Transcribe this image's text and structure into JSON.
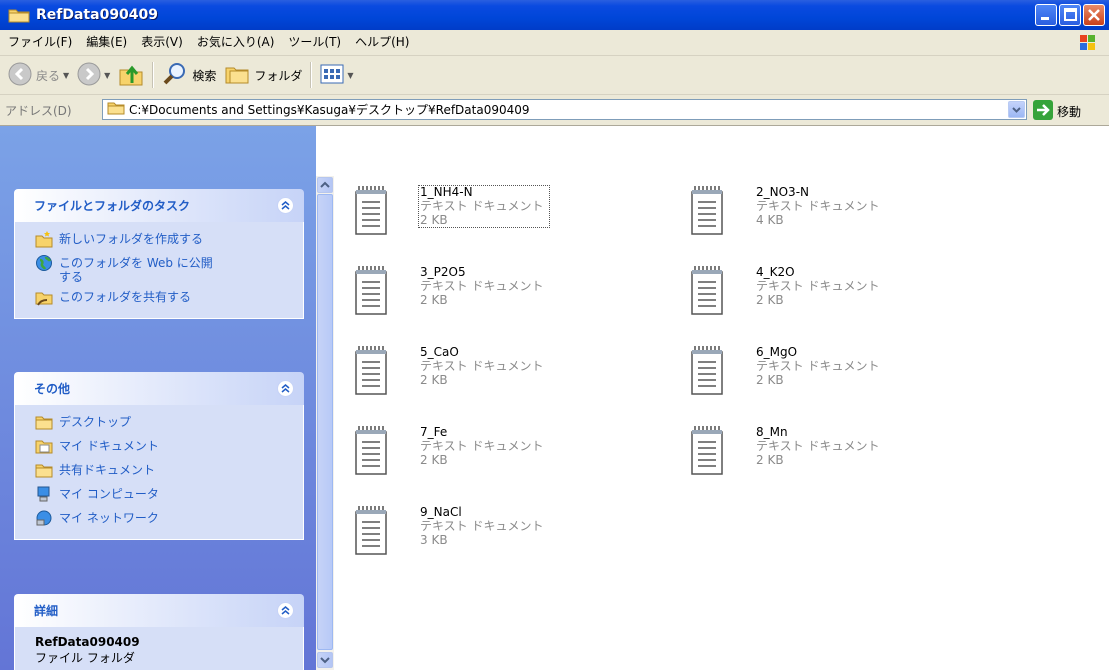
{
  "window": {
    "title": "RefData090409"
  },
  "menu": [
    "ファイル(F)",
    "編集(E)",
    "表示(V)",
    "お気に入り(A)",
    "ツール(T)",
    "ヘルプ(H)"
  ],
  "toolbar": {
    "back": "戻る",
    "search": "検索",
    "folders": "フォルダ"
  },
  "address": {
    "label": "アドレス(D)",
    "path": "C:¥Documents and Settings¥Kasuga¥デスクトップ¥RefData090409",
    "go": "移動"
  },
  "tasks": {
    "title": "ファイルとフォルダのタスク",
    "items": [
      "新しいフォルダを作成する",
      "このフォルダを Web に公開\nする",
      "このフォルダを共有する"
    ]
  },
  "other": {
    "title": "その他",
    "items": [
      "デスクトップ",
      "マイ ドキュメント",
      "共有ドキュメント",
      "マイ コンピュータ",
      "マイ ネットワーク"
    ]
  },
  "details": {
    "title": "詳細",
    "name": "RefData090409",
    "type": "ファイル フォルダ"
  },
  "files": [
    {
      "name": "1_NH4-N",
      "type": "テキスト ドキュメント",
      "size": "2 KB"
    },
    {
      "name": "2_NO3-N",
      "type": "テキスト ドキュメント",
      "size": "4 KB"
    },
    {
      "name": "3_P2O5",
      "type": "テキスト ドキュメント",
      "size": "2 KB"
    },
    {
      "name": "4_K2O",
      "type": "テキスト ドキュメント",
      "size": "2 KB"
    },
    {
      "name": "5_CaO",
      "type": "テキスト ドキュメント",
      "size": "2 KB"
    },
    {
      "name": "6_MgO",
      "type": "テキスト ドキュメント",
      "size": "2 KB"
    },
    {
      "name": "7_Fe",
      "type": "テキスト ドキュメント",
      "size": "2 KB"
    },
    {
      "name": "8_Mn",
      "type": "テキスト ドキュメント",
      "size": "2 KB"
    },
    {
      "name": "9_NaCl",
      "type": "テキスト ドキュメント",
      "size": "3 KB"
    }
  ]
}
